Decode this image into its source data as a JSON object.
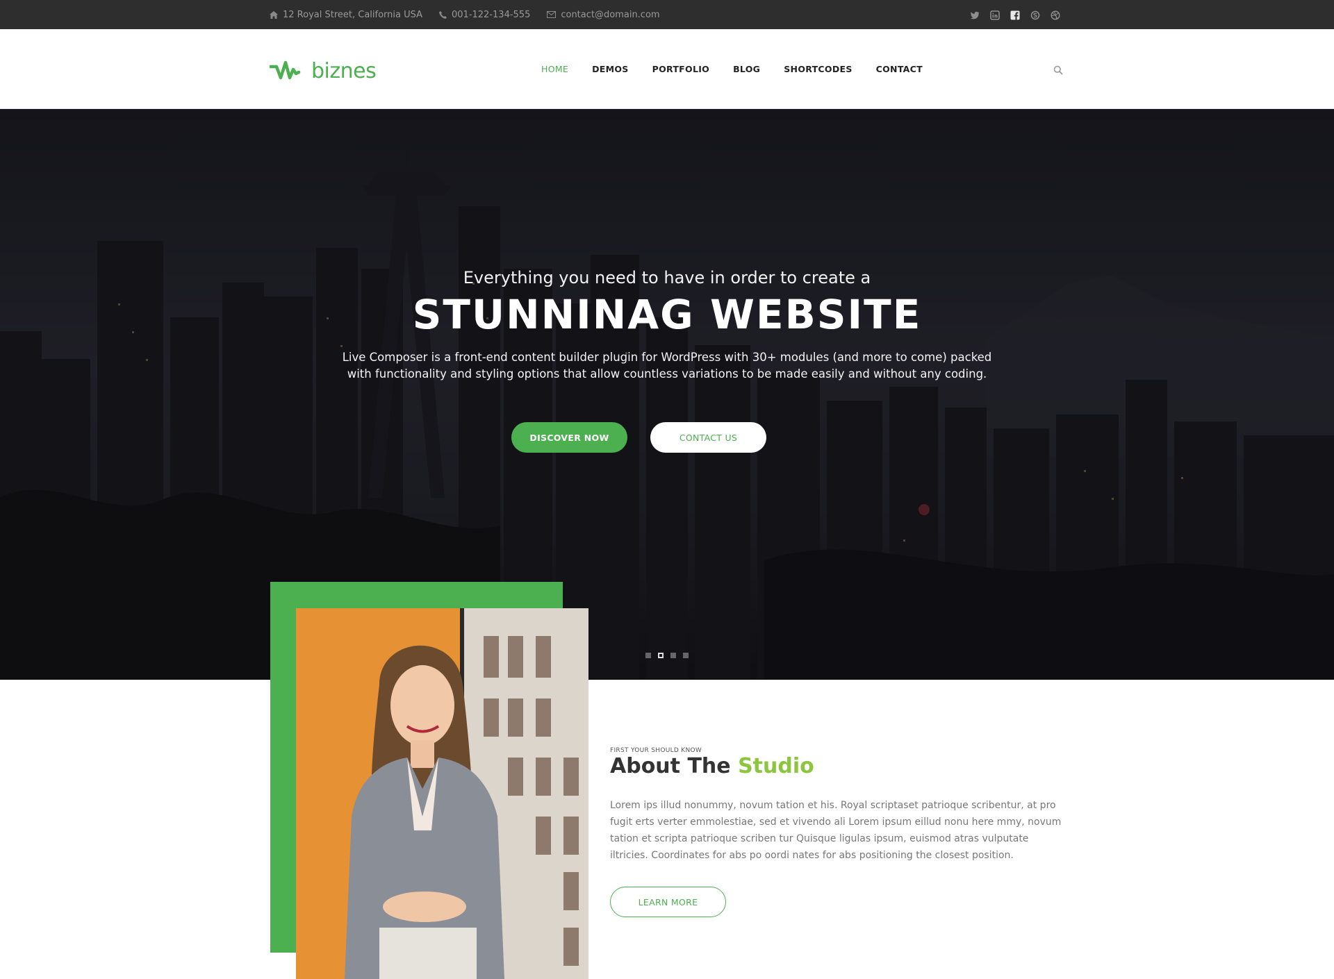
{
  "topbar": {
    "address": "12 Royal Street, California USA",
    "phone": "001-122-134-555",
    "email": "contact@domain.com",
    "social_icons": [
      "twitter-icon",
      "linkedin-icon",
      "facebook-icon",
      "skype-icon",
      "dribbble-icon"
    ]
  },
  "header": {
    "logo_text": "biznes",
    "nav": [
      {
        "label": "HOME",
        "active": true
      },
      {
        "label": "DEMOS",
        "active": false
      },
      {
        "label": "PORTFOLIO",
        "active": false
      },
      {
        "label": "BLOG",
        "active": false
      },
      {
        "label": "SHORTCODES",
        "active": false
      },
      {
        "label": "CONTACT",
        "active": false
      }
    ],
    "search_icon": "search-icon"
  },
  "hero": {
    "subtitle": "Everything you need to have in order to create a",
    "title": "STUNNINAG WEBSITE",
    "description": "Live Composer is a front-end content builder plugin for WordPress with 30+ modules (and more to come) packed with functionality and styling options that allow countless variations to be made easily and without any coding.",
    "primary_button": "DISCOVER NOW",
    "secondary_button": "CONTACT US",
    "slides_total": 4,
    "active_slide": 2
  },
  "about": {
    "pre_title": "FIRST YOUR SHOULD KNOW",
    "title_main": "About The",
    "title_accent": "Studio",
    "text": "Lorem ips illud nonummy, novum tation et his. Royal scriptaset patrioque scribentur, at pro fugit erts verter emmolestiae, sed et vivendo ali Lorem ipsum eillud nonu here mmy, novum tation et scripta patrioque scriben tur Quisque ligulas ipsum, euismod atras vulputate iltricies. Coordinates for abs po oordi nates for abs positioning the closest position.",
    "button": "LEARN MORE"
  },
  "colors": {
    "accent": "#4caf50",
    "accent_light": "#8cc63f",
    "topbar_bg": "#2e2e2f",
    "hero_bg": "#1e1e25"
  }
}
